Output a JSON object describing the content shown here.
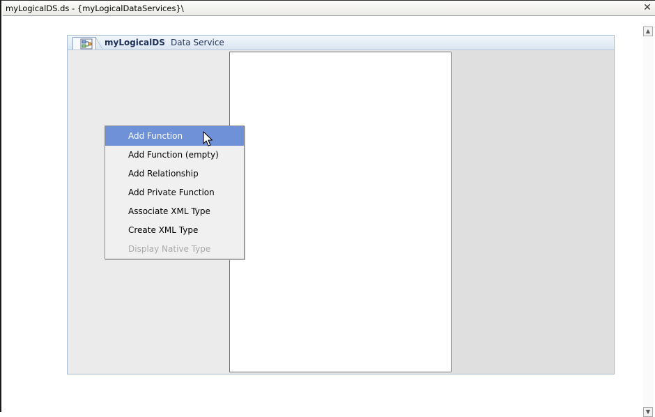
{
  "window": {
    "title": "myLogicalDS.ds - {myLogicalDataServices}\\",
    "close_glyph": "✕"
  },
  "panel": {
    "name": "myLogicalDS",
    "suffix": "Data Service",
    "icon": "data-service-icon"
  },
  "context_menu": {
    "items": [
      {
        "label": "Add Function",
        "state": "selected"
      },
      {
        "label": "Add Function (empty)",
        "state": "normal"
      },
      {
        "label": "Add Relationship",
        "state": "normal"
      },
      {
        "label": "Add Private Function",
        "state": "normal"
      },
      {
        "label": "Associate XML Type",
        "state": "normal"
      },
      {
        "label": "Create XML Type",
        "state": "normal"
      },
      {
        "label": "Display Native Type",
        "state": "disabled"
      }
    ]
  },
  "scrollbar": {
    "up_glyph": "▲",
    "down_glyph": "▼"
  },
  "colors": {
    "menu_highlight": "#6f91d8",
    "panel_title": "#1d2f55"
  }
}
